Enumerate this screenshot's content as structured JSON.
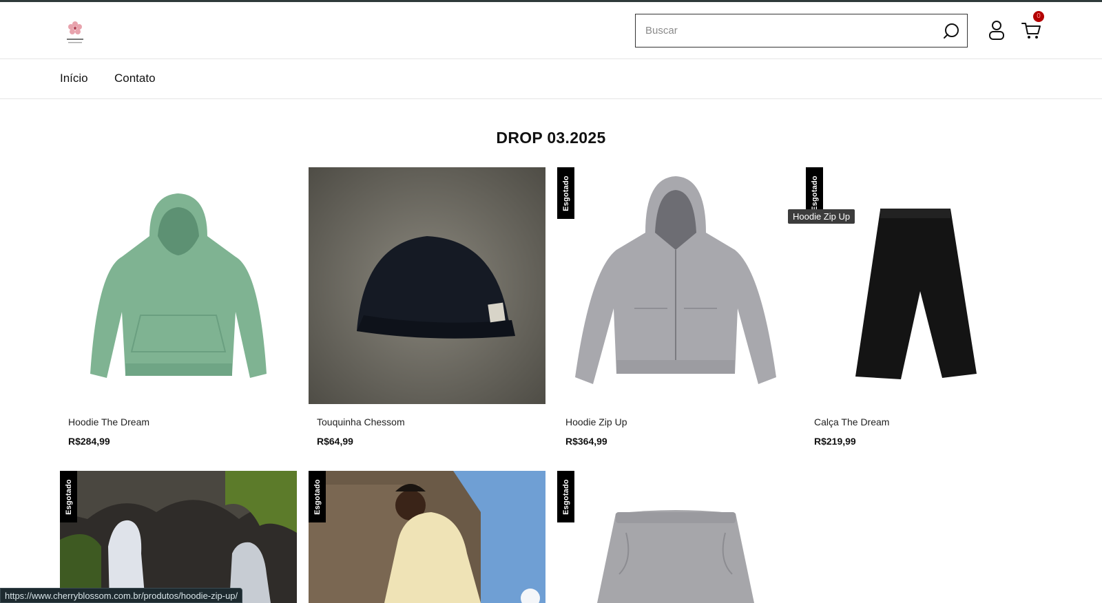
{
  "header": {
    "logo_text": "CHERRY BLOSSOM",
    "search": {
      "placeholder": "Buscar",
      "value": ""
    },
    "cart_count": "0"
  },
  "nav": [
    {
      "label": "Início"
    },
    {
      "label": "Contato"
    }
  ],
  "section": {
    "title": "DROP 03.2025"
  },
  "products": [
    {
      "name": "Hoodie The Dream",
      "price": "R$284,99",
      "badge": "",
      "image": "green-hoodie"
    },
    {
      "name": "Touquinha Chessom",
      "price": "R$64,99",
      "badge": "",
      "image": "black-beanie"
    },
    {
      "name": "Hoodie Zip Up",
      "price": "R$364,99",
      "badge": "Esgotado",
      "image": "grey-zip-hoodie"
    },
    {
      "name": "Calça The Dream",
      "price": "R$219,99",
      "badge": "Esgotado",
      "image": "black-pants"
    },
    {
      "badge": "Esgotado",
      "image": "white-hoodies-waterfall"
    },
    {
      "badge": "Esgotado",
      "image": "cream-hoodie-model"
    },
    {
      "badge": "Esgotado",
      "image": "grey-shorts"
    }
  ],
  "tooltip": "Hoodie Zip Up",
  "status_url": "https://www.cherryblossom.com.br/produtos/hoodie-zip-up/",
  "colors": {
    "top_bar": "#2f3b3b",
    "badge_bg": "#000000",
    "cart_badge": "#b30000"
  }
}
